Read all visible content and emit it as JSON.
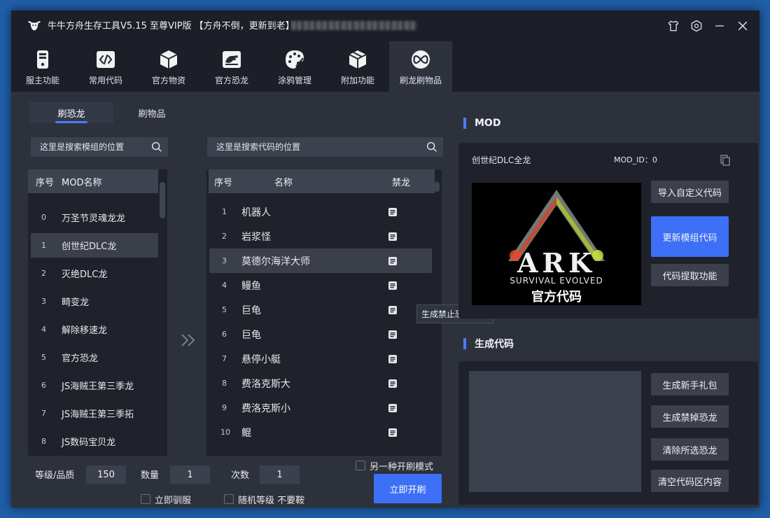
{
  "window": {
    "title": "牛牛方舟生存工具V5.15 至尊VIP版 【方舟不倒，更新到老】"
  },
  "toolbar": {
    "items": [
      {
        "label": "服主功能",
        "icon": "server-icon"
      },
      {
        "label": "常用代码",
        "icon": "code-icon"
      },
      {
        "label": "官方物资",
        "icon": "box-icon"
      },
      {
        "label": "官方恐龙",
        "icon": "dino-icon"
      },
      {
        "label": "涂鸦管理",
        "icon": "palette-icon"
      },
      {
        "label": "附加功能",
        "icon": "package-icon"
      },
      {
        "label": "刷龙刷物品",
        "icon": "infinity-icon"
      }
    ],
    "active_index": 6
  },
  "subtabs": [
    "刷恐龙",
    "刷物品"
  ],
  "mod_search": {
    "placeholder": "这里是搜索模组的位置"
  },
  "code_search": {
    "placeholder": "这里是搜索代码的位置"
  },
  "mod_table": {
    "headers": [
      "序号",
      "MOD名称"
    ],
    "rows": [
      {
        "no": "0",
        "name": "万圣节灵魂龙龙"
      },
      {
        "no": "1",
        "name": "创世纪DLC龙"
      },
      {
        "no": "2",
        "name": "灭绝DLC龙"
      },
      {
        "no": "3",
        "name": "畸变龙"
      },
      {
        "no": "4",
        "name": "解除移速龙"
      },
      {
        "no": "5",
        "name": "官方恐龙"
      },
      {
        "no": "6",
        "name": "JS海贼王第三季龙"
      },
      {
        "no": "7",
        "name": "JS海贼王第三季拓"
      },
      {
        "no": "8",
        "name": "JS数码宝贝龙"
      }
    ],
    "selected_index": 1
  },
  "code_table": {
    "headers": [
      "序号",
      "名称",
      "禁龙"
    ],
    "rows": [
      {
        "no": "1",
        "name": "机器人"
      },
      {
        "no": "2",
        "name": "岩浆怪"
      },
      {
        "no": "3",
        "name": "莫德尔海洋大师"
      },
      {
        "no": "4",
        "name": "鳗鱼"
      },
      {
        "no": "5",
        "name": "巨龟"
      },
      {
        "no": "6",
        "name": "巨龟"
      },
      {
        "no": "7",
        "name": "悬停小艇"
      },
      {
        "no": "8",
        "name": "费洛克斯大"
      },
      {
        "no": "9",
        "name": "费洛克斯小"
      },
      {
        "no": "10",
        "name": "鲲"
      }
    ],
    "selected_index": 2
  },
  "tooltip": "生成禁止恐龙刷新",
  "mod_section": {
    "title": "MOD",
    "mod_name": "创世纪DLC全龙",
    "mod_id_label": "MOD_ID：0",
    "image": {
      "big": "ARK",
      "sub": "SURVIVAL EVOLVED",
      "caption": "官方代码"
    },
    "buttons": [
      "导入自定义代码",
      "更新模组代码",
      "代码提取功能"
    ]
  },
  "gen_section": {
    "title": "生成代码",
    "buttons": [
      "生成新手礼包",
      "生成禁掉恐龙",
      "清除所选恐龙",
      "清空代码区内容"
    ]
  },
  "controls": {
    "level_label": "等级/品质",
    "level_value": "150",
    "qty_label": "数量",
    "qty_value": "1",
    "times_label": "次数",
    "times_value": "1",
    "tame_label": "立即驯服",
    "random_label": "随机等级 不要鞍",
    "alt_mode_label": "另一种开刷模式",
    "start_label": "立即开刷"
  },
  "colors": {
    "accent": "#3d6ff7",
    "bg": "#2d313c",
    "panel": "#1f222b"
  }
}
